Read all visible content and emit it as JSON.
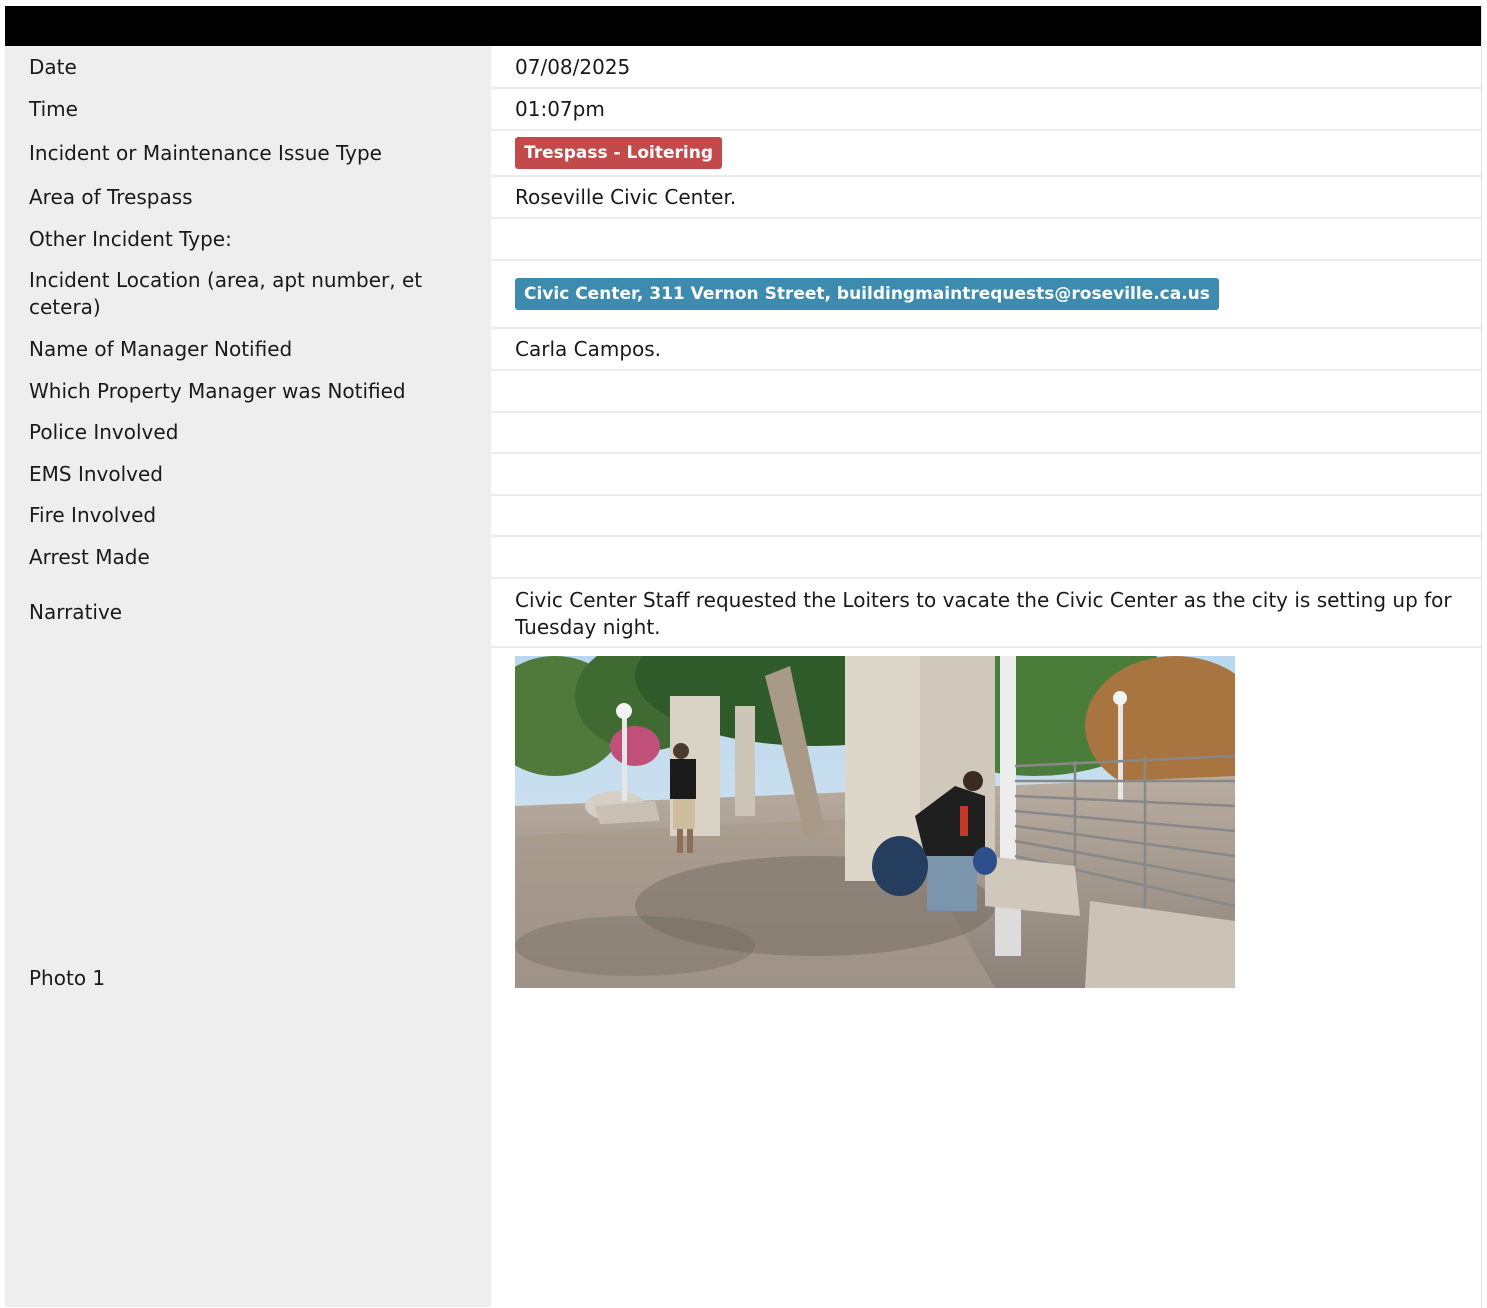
{
  "report": {
    "rows": {
      "date": {
        "label": "Date",
        "value": "07/08/2025"
      },
      "time": {
        "label": "Time",
        "value": "01:07pm"
      },
      "incident_type": {
        "label": "Incident or Maintenance Issue Type",
        "value": "Trespass - Loitering",
        "badge_color": "#c24a4a"
      },
      "area_of_trespass": {
        "label": "Area of Trespass",
        "value": "Roseville Civic Center."
      },
      "other_incident_type": {
        "label": "Other Incident Type:",
        "value": ""
      },
      "incident_location": {
        "label": "Incident Location (area, apt number, et cetera)",
        "value": "Civic Center, 311 Vernon Street, buildingmaintrequests@roseville.ca.us",
        "badge_color": "#3d8cb0"
      },
      "manager_notified": {
        "label": "Name of Manager Notified",
        "value": "Carla Campos."
      },
      "property_manager": {
        "label": "Which Property Manager was Notified",
        "value": ""
      },
      "police_involved": {
        "label": "Police Involved",
        "value": ""
      },
      "ems_involved": {
        "label": "EMS Involved",
        "value": ""
      },
      "fire_involved": {
        "label": "Fire Involved",
        "value": ""
      },
      "arrest_made": {
        "label": "Arrest Made",
        "value": ""
      },
      "narrative": {
        "label": "Narrative",
        "value": "Civic Center Staff requested the Loiters to vacate the Civic Center as the city is setting up for Tuesday night."
      },
      "photo_1": {
        "label": "Photo 1"
      }
    }
  }
}
